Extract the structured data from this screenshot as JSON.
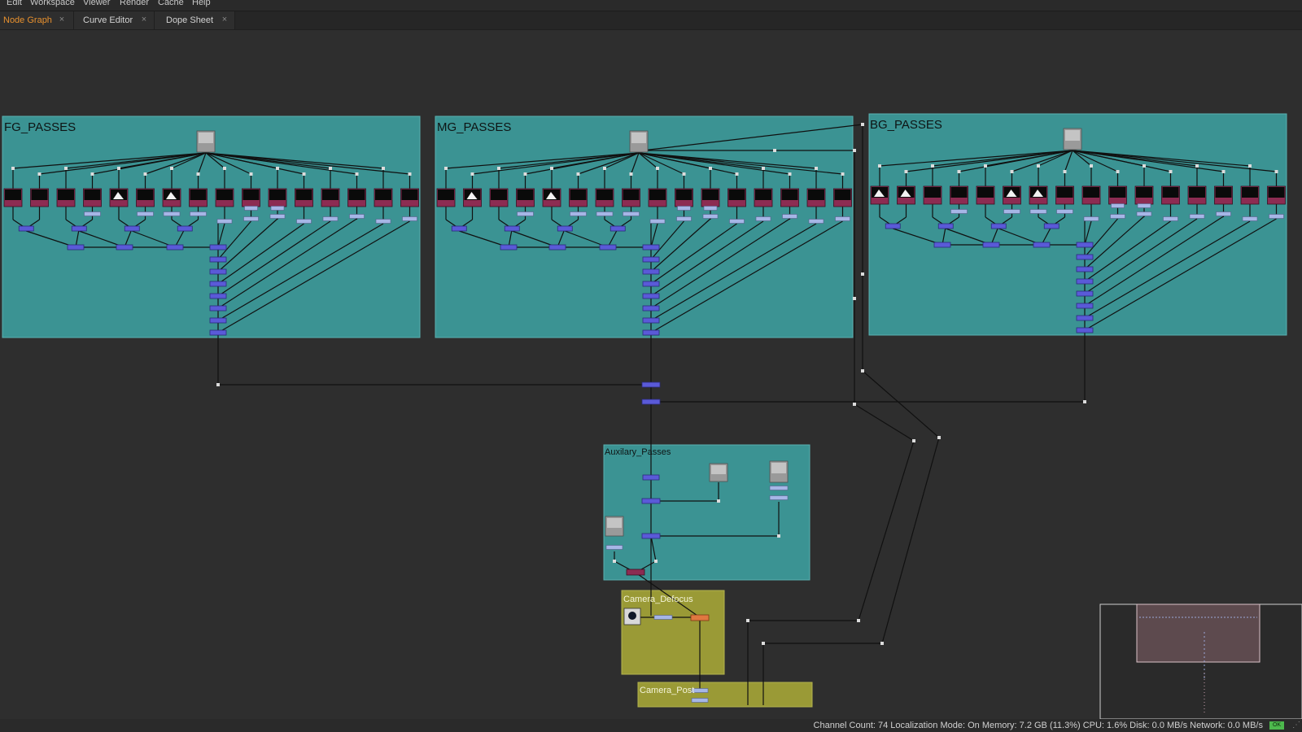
{
  "menu": [
    "Edit",
    "Workspace",
    "Viewer",
    "Render",
    "Cache",
    "Help"
  ],
  "tabs": [
    {
      "label": "Node Graph",
      "active": true
    },
    {
      "label": "Curve Editor",
      "active": false
    },
    {
      "label": "Dope Sheet",
      "active": false
    }
  ],
  "backdrops": {
    "fg": "FG_PASSES",
    "mg": "MG_PASSES",
    "bg": "BG_PASSES",
    "aux": "Auxilary_Passes",
    "defocus": "Camera_Defocus",
    "post": "Camera_Post"
  },
  "status": {
    "text": "Channel Count: 74  Localization Mode: On  Memory: 7.2 GB (11.3%)  CPU: 1.6%  Disk: 0.0 MB/s  Network: 0.0 MB/s",
    "ok": "OK"
  },
  "colors": {
    "backdrop_teal": "#3b9393",
    "backdrop_olive": "#9a9a36",
    "node_read": "#8c2c52",
    "node_merge": "#5a5ad8",
    "node_shuffle": "#a6b6e6",
    "node_grade": "#e07840",
    "active_tab": "#e8912e"
  }
}
